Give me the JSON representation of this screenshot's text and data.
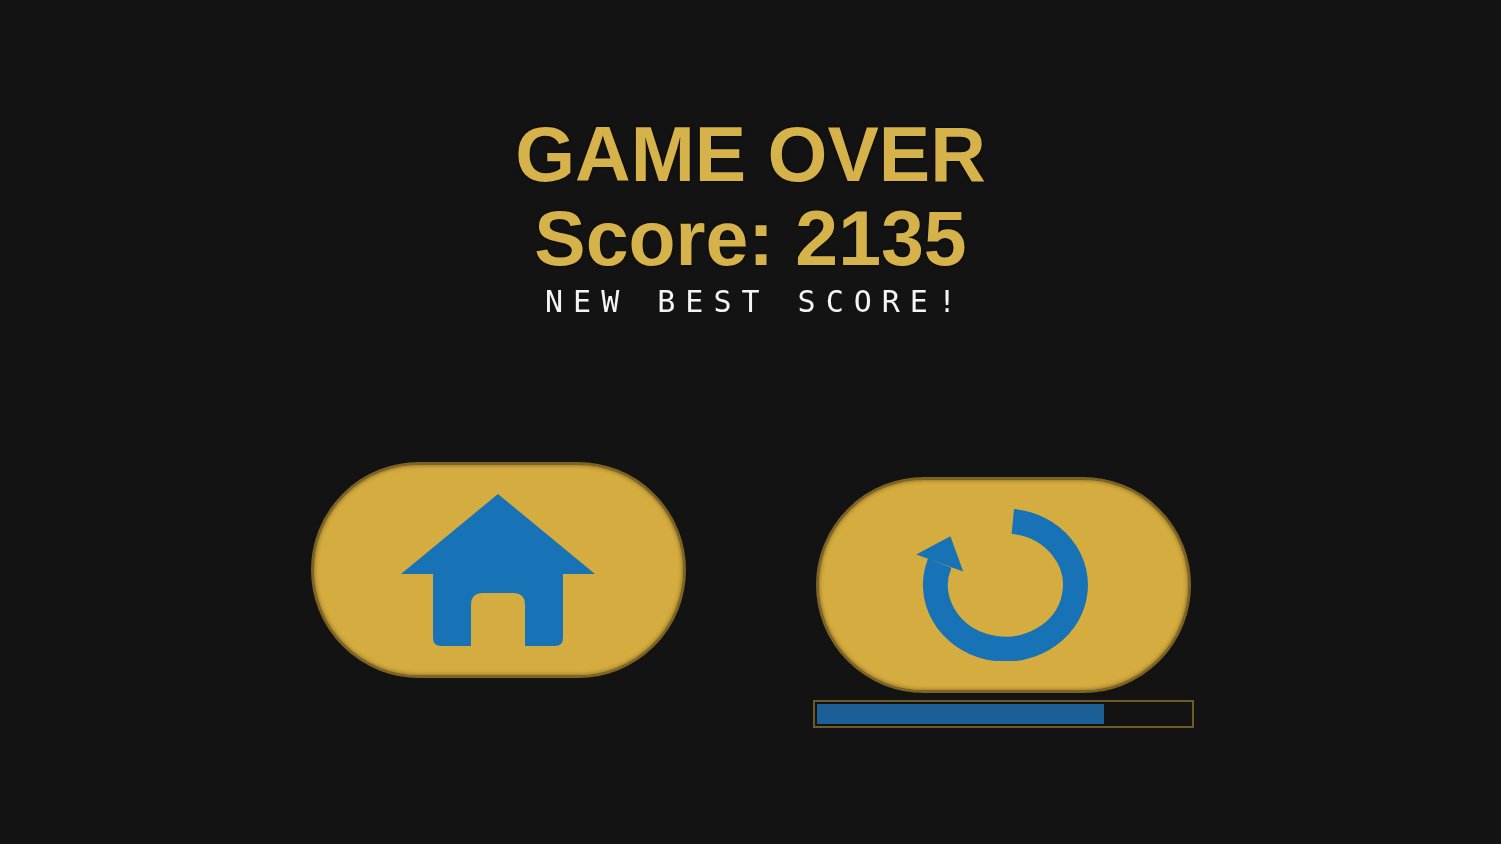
{
  "title": "GAME OVER",
  "score": "Score: 2135",
  "message": "NEW BEST SCORE!",
  "buttons": [
    {
      "kind": "home"
    },
    {
      "kind": "restart"
    }
  ],
  "progress_bar": {
    "level": 0.77
  }
}
